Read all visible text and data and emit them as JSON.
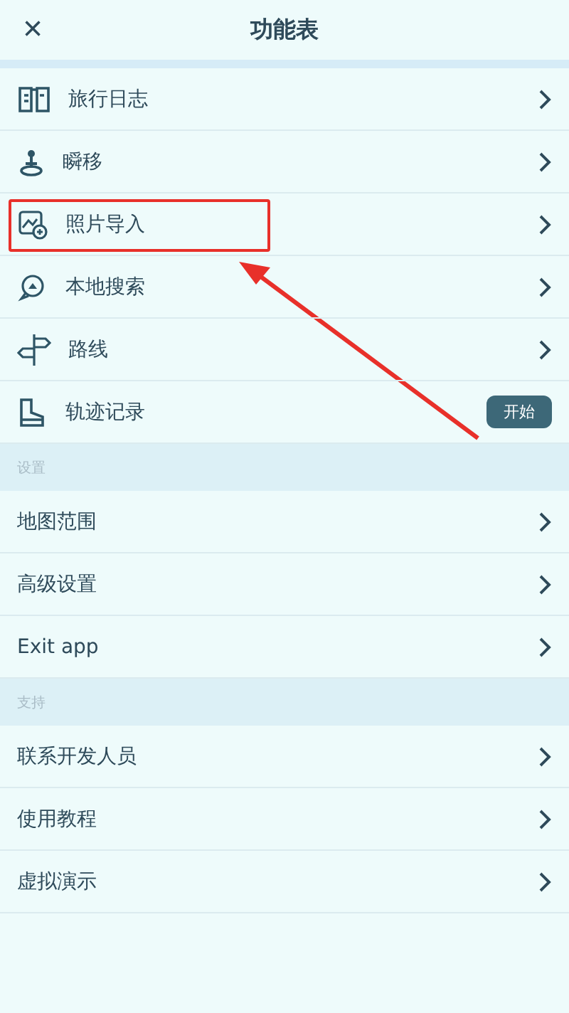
{
  "header": {
    "close": "×",
    "title": "功能表"
  },
  "sections": [
    {
      "items": [
        {
          "label": "旅行日志",
          "kind": "link",
          "highlighted": false
        },
        {
          "label": "瞬移",
          "kind": "link",
          "highlighted": false
        },
        {
          "label": "照片导入",
          "kind": "link",
          "highlighted": true
        },
        {
          "label": "本地搜索",
          "kind": "link",
          "highlighted": false
        },
        {
          "label": "路线",
          "kind": "link",
          "highlighted": false
        },
        {
          "label": "轨迹记录",
          "kind": "action",
          "button": "开始",
          "highlighted": false
        }
      ]
    },
    {
      "title": "设置",
      "items": [
        {
          "label": "地图范围",
          "kind": "link",
          "highlighted": false
        },
        {
          "label": "高级设置",
          "kind": "link",
          "highlighted": false
        },
        {
          "label": "Exit app",
          "kind": "link",
          "highlighted": false
        }
      ]
    },
    {
      "title": "支持",
      "items": [
        {
          "label": "联系开发人员",
          "kind": "link",
          "highlighted": false
        },
        {
          "label": "使用教程",
          "kind": "link",
          "highlighted": false
        },
        {
          "label": "虚拟演示",
          "kind": "link",
          "highlighted": false
        }
      ]
    }
  ]
}
